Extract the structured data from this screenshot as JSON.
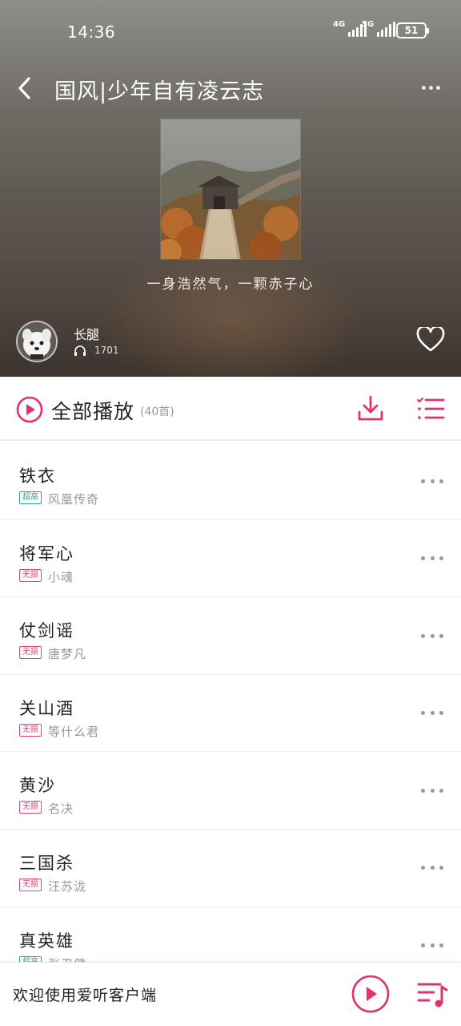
{
  "status_bar": {
    "time": "14:36",
    "network1": "4G",
    "network2": "5G",
    "battery": "51"
  },
  "nav": {
    "title": "国风|少年自有凌云志"
  },
  "playlist": {
    "tagline": "一身浩然气，一颗赤子心",
    "creator": "长腿",
    "listen_count": "1701"
  },
  "toolbar": {
    "play_all_label": "全部播放",
    "song_count": "(40首)"
  },
  "songs": [
    {
      "title": "铁衣",
      "quality": "超高",
      "artist": "风凰传奇"
    },
    {
      "title": "将军心",
      "quality": "无损",
      "artist": "小魂"
    },
    {
      "title": "仗剑谣",
      "quality": "无损",
      "artist": "唐梦凡"
    },
    {
      "title": "关山酒",
      "quality": "无损",
      "artist": "等什么君"
    },
    {
      "title": "黄沙",
      "quality": "无损",
      "artist": "名决"
    },
    {
      "title": "三国杀",
      "quality": "无损",
      "artist": "汪苏泷"
    },
    {
      "title": "真英雄",
      "quality": "超高",
      "artist": "张卫健"
    }
  ],
  "player": {
    "welcome": "欢迎使用爱听客户端"
  },
  "colors": {
    "accent": "#e0336b",
    "super_quality": "#2aa58c",
    "lossless_quality": "#e0476e"
  },
  "icons": {
    "back": "chevron-left-icon",
    "more": "more-dots-icon",
    "headphones": "headphones-icon",
    "like": "heart-icon",
    "play_all": "play-circle-icon",
    "download": "download-icon",
    "list_select": "checklist-icon",
    "queue": "music-queue-icon"
  }
}
